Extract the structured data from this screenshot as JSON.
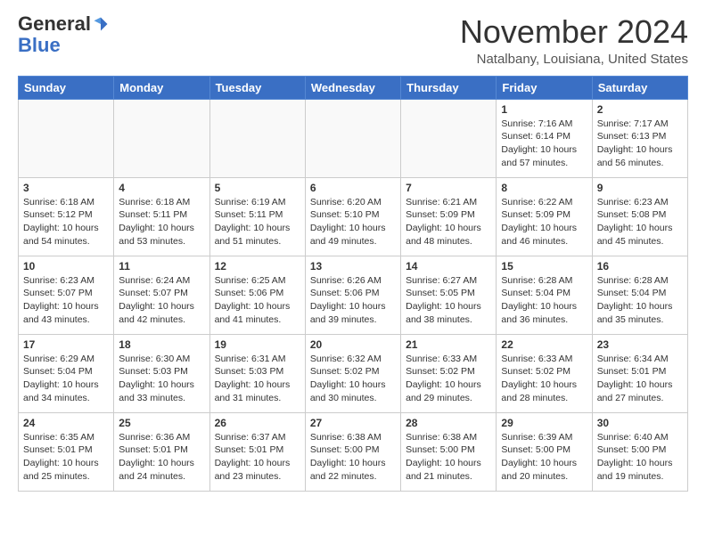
{
  "header": {
    "logo_general": "General",
    "logo_blue": "Blue",
    "month_title": "November 2024",
    "location": "Natalbany, Louisiana, United States"
  },
  "weekdays": [
    "Sunday",
    "Monday",
    "Tuesday",
    "Wednesday",
    "Thursday",
    "Friday",
    "Saturday"
  ],
  "weeks": [
    [
      {
        "day": "",
        "info": ""
      },
      {
        "day": "",
        "info": ""
      },
      {
        "day": "",
        "info": ""
      },
      {
        "day": "",
        "info": ""
      },
      {
        "day": "",
        "info": ""
      },
      {
        "day": "1",
        "info": "Sunrise: 7:16 AM\nSunset: 6:14 PM\nDaylight: 10 hours and 57 minutes."
      },
      {
        "day": "2",
        "info": "Sunrise: 7:17 AM\nSunset: 6:13 PM\nDaylight: 10 hours and 56 minutes."
      }
    ],
    [
      {
        "day": "3",
        "info": "Sunrise: 6:18 AM\nSunset: 5:12 PM\nDaylight: 10 hours and 54 minutes."
      },
      {
        "day": "4",
        "info": "Sunrise: 6:18 AM\nSunset: 5:11 PM\nDaylight: 10 hours and 53 minutes."
      },
      {
        "day": "5",
        "info": "Sunrise: 6:19 AM\nSunset: 5:11 PM\nDaylight: 10 hours and 51 minutes."
      },
      {
        "day": "6",
        "info": "Sunrise: 6:20 AM\nSunset: 5:10 PM\nDaylight: 10 hours and 49 minutes."
      },
      {
        "day": "7",
        "info": "Sunrise: 6:21 AM\nSunset: 5:09 PM\nDaylight: 10 hours and 48 minutes."
      },
      {
        "day": "8",
        "info": "Sunrise: 6:22 AM\nSunset: 5:09 PM\nDaylight: 10 hours and 46 minutes."
      },
      {
        "day": "9",
        "info": "Sunrise: 6:23 AM\nSunset: 5:08 PM\nDaylight: 10 hours and 45 minutes."
      }
    ],
    [
      {
        "day": "10",
        "info": "Sunrise: 6:23 AM\nSunset: 5:07 PM\nDaylight: 10 hours and 43 minutes."
      },
      {
        "day": "11",
        "info": "Sunrise: 6:24 AM\nSunset: 5:07 PM\nDaylight: 10 hours and 42 minutes."
      },
      {
        "day": "12",
        "info": "Sunrise: 6:25 AM\nSunset: 5:06 PM\nDaylight: 10 hours and 41 minutes."
      },
      {
        "day": "13",
        "info": "Sunrise: 6:26 AM\nSunset: 5:06 PM\nDaylight: 10 hours and 39 minutes."
      },
      {
        "day": "14",
        "info": "Sunrise: 6:27 AM\nSunset: 5:05 PM\nDaylight: 10 hours and 38 minutes."
      },
      {
        "day": "15",
        "info": "Sunrise: 6:28 AM\nSunset: 5:04 PM\nDaylight: 10 hours and 36 minutes."
      },
      {
        "day": "16",
        "info": "Sunrise: 6:28 AM\nSunset: 5:04 PM\nDaylight: 10 hours and 35 minutes."
      }
    ],
    [
      {
        "day": "17",
        "info": "Sunrise: 6:29 AM\nSunset: 5:04 PM\nDaylight: 10 hours and 34 minutes."
      },
      {
        "day": "18",
        "info": "Sunrise: 6:30 AM\nSunset: 5:03 PM\nDaylight: 10 hours and 33 minutes."
      },
      {
        "day": "19",
        "info": "Sunrise: 6:31 AM\nSunset: 5:03 PM\nDaylight: 10 hours and 31 minutes."
      },
      {
        "day": "20",
        "info": "Sunrise: 6:32 AM\nSunset: 5:02 PM\nDaylight: 10 hours and 30 minutes."
      },
      {
        "day": "21",
        "info": "Sunrise: 6:33 AM\nSunset: 5:02 PM\nDaylight: 10 hours and 29 minutes."
      },
      {
        "day": "22",
        "info": "Sunrise: 6:33 AM\nSunset: 5:02 PM\nDaylight: 10 hours and 28 minutes."
      },
      {
        "day": "23",
        "info": "Sunrise: 6:34 AM\nSunset: 5:01 PM\nDaylight: 10 hours and 27 minutes."
      }
    ],
    [
      {
        "day": "24",
        "info": "Sunrise: 6:35 AM\nSunset: 5:01 PM\nDaylight: 10 hours and 25 minutes."
      },
      {
        "day": "25",
        "info": "Sunrise: 6:36 AM\nSunset: 5:01 PM\nDaylight: 10 hours and 24 minutes."
      },
      {
        "day": "26",
        "info": "Sunrise: 6:37 AM\nSunset: 5:01 PM\nDaylight: 10 hours and 23 minutes."
      },
      {
        "day": "27",
        "info": "Sunrise: 6:38 AM\nSunset: 5:00 PM\nDaylight: 10 hours and 22 minutes."
      },
      {
        "day": "28",
        "info": "Sunrise: 6:38 AM\nSunset: 5:00 PM\nDaylight: 10 hours and 21 minutes."
      },
      {
        "day": "29",
        "info": "Sunrise: 6:39 AM\nSunset: 5:00 PM\nDaylight: 10 hours and 20 minutes."
      },
      {
        "day": "30",
        "info": "Sunrise: 6:40 AM\nSunset: 5:00 PM\nDaylight: 10 hours and 19 minutes."
      }
    ]
  ]
}
